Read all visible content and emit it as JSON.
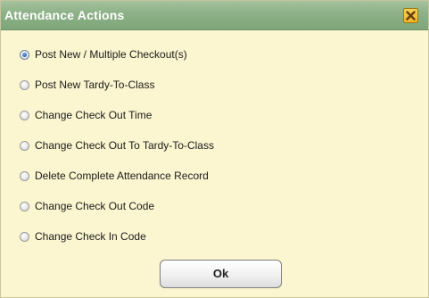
{
  "dialog": {
    "title": "Attendance Actions",
    "close_icon": "close-icon",
    "selected_option_index": 0,
    "options": [
      {
        "label": "Post New / Multiple Checkout(s)",
        "checked": true
      },
      {
        "label": "Post New Tardy-To-Class",
        "checked": false
      },
      {
        "label": "Change Check Out Time",
        "checked": false
      },
      {
        "label": "Change Check Out To Tardy-To-Class",
        "checked": false
      },
      {
        "label": "Delete Complete Attendance Record",
        "checked": false
      },
      {
        "label": "Change Check Out Code",
        "checked": false
      },
      {
        "label": "Change Check In Code",
        "checked": false
      }
    ],
    "ok_label": "Ok"
  },
  "colors": {
    "titlebar": "#8db088",
    "body_background": "#fbf6d0",
    "close_button": "#ecb328",
    "radio_selected": "#2a5fae"
  }
}
